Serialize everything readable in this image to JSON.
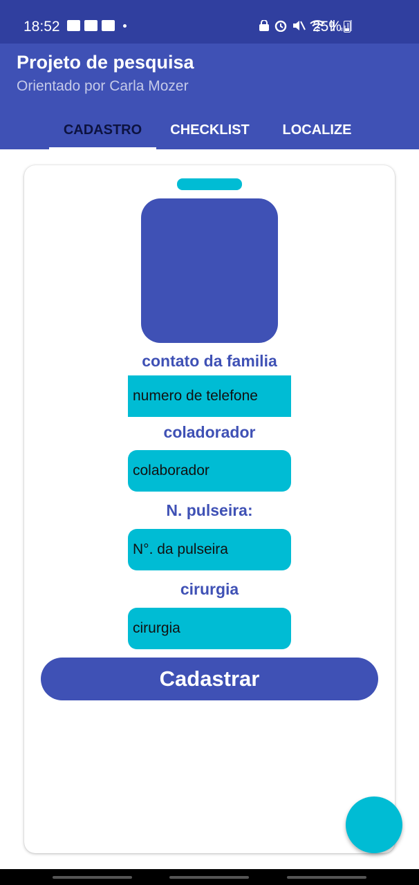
{
  "status_bar": {
    "time": "18:52",
    "battery": "25%",
    "left_icons": [
      "image-icon",
      "voicemail-icon",
      "teams-icon"
    ],
    "right_icons": [
      "vpn-icon",
      "alarm-icon",
      "mute-icon",
      "wifi-icon",
      "data-icon",
      "signal-icon"
    ]
  },
  "app_bar": {
    "title": "Projeto de pesquisa",
    "subtitle": "Orientado por Carla Mozer",
    "tabs": [
      {
        "label": "CADASTRO",
        "active": true
      },
      {
        "label": "CHECKLIST",
        "active": false
      },
      {
        "label": "LOCALIZE",
        "active": false
      }
    ]
  },
  "form": {
    "labels": {
      "contact": "contato da familia",
      "collaborator": "coladorador",
      "wristband": "N. pulseira:",
      "surgery": "cirurgia"
    },
    "placeholders": {
      "contact": "numero de telefone",
      "collaborator": "colaborador",
      "wristband": "N°. da pulseira",
      "surgery": "cirurgia"
    },
    "submit_label": "Cadastrar"
  },
  "colors": {
    "primary": "#3f51b5",
    "primary_dark": "#303f9f",
    "accent": "#00bcd4"
  }
}
